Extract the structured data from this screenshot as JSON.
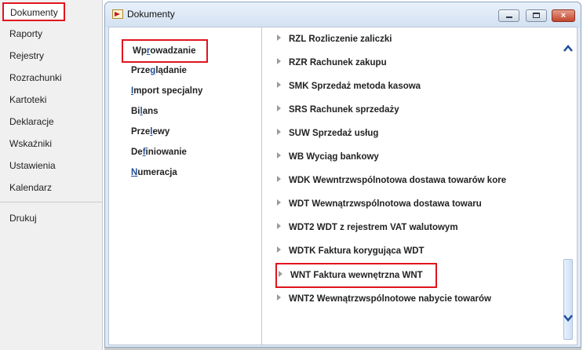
{
  "nav": {
    "items": [
      {
        "label": "Dokumenty",
        "selected": true
      },
      {
        "label": "Raporty"
      },
      {
        "label": "Rejestry"
      },
      {
        "label": "Rozrachunki"
      },
      {
        "label": "Kartoteki"
      },
      {
        "label": "Deklaracje"
      },
      {
        "label": "Wskaźniki"
      },
      {
        "label": "Ustawienia"
      },
      {
        "label": "Kalendarz"
      }
    ],
    "print_label": "Drukuj"
  },
  "window": {
    "title": "Dokumenty",
    "icon": "documents-window-icon",
    "buttons": {
      "minimize": "minimize-icon",
      "maximize": "maximize-icon",
      "close": "×"
    }
  },
  "submenu": {
    "items": [
      {
        "label": "Wprowadzanie",
        "mnemonic": "r",
        "selected": true
      },
      {
        "label": "Przeglądanie",
        "mnemonic": "g"
      },
      {
        "label": "Import specjalny",
        "mnemonic": "I"
      },
      {
        "label": "Bilans",
        "mnemonic": "l"
      },
      {
        "label": "Przelewy",
        "mnemonic": "l"
      },
      {
        "label": "Definiowanie",
        "mnemonic": "f"
      },
      {
        "label": "Numeracja",
        "mnemonic": "N"
      }
    ]
  },
  "documents": {
    "items": [
      {
        "label": "RZL Rozliczenie zaliczki"
      },
      {
        "label": "RZR Rachunek zakupu"
      },
      {
        "label": "SMK Sprzedaż metoda kasowa"
      },
      {
        "label": "SRS Rachunek sprzedaży"
      },
      {
        "label": "SUW Sprzedaż usług"
      },
      {
        "label": "WB Wyciąg bankowy"
      },
      {
        "label": "WDK Wewntrzwspólnotowa dostawa towarów kore"
      },
      {
        "label": "WDT Wewnątrzwspólnotowa dostawa towaru"
      },
      {
        "label": "WDT2 WDT z rejestrem VAT walutowym"
      },
      {
        "label": "WDTK Faktura korygująca WDT"
      },
      {
        "label": "WNT Faktura wewnętrzna WNT",
        "highlighted": true
      },
      {
        "label": "WNT2 Wewnątrzwspólnotowe nabycie towarów"
      }
    ]
  },
  "colors": {
    "highlight_border": "#e0141e",
    "window_frame": "#dfe9f5",
    "scroll_arrow": "#1f4f9c"
  }
}
